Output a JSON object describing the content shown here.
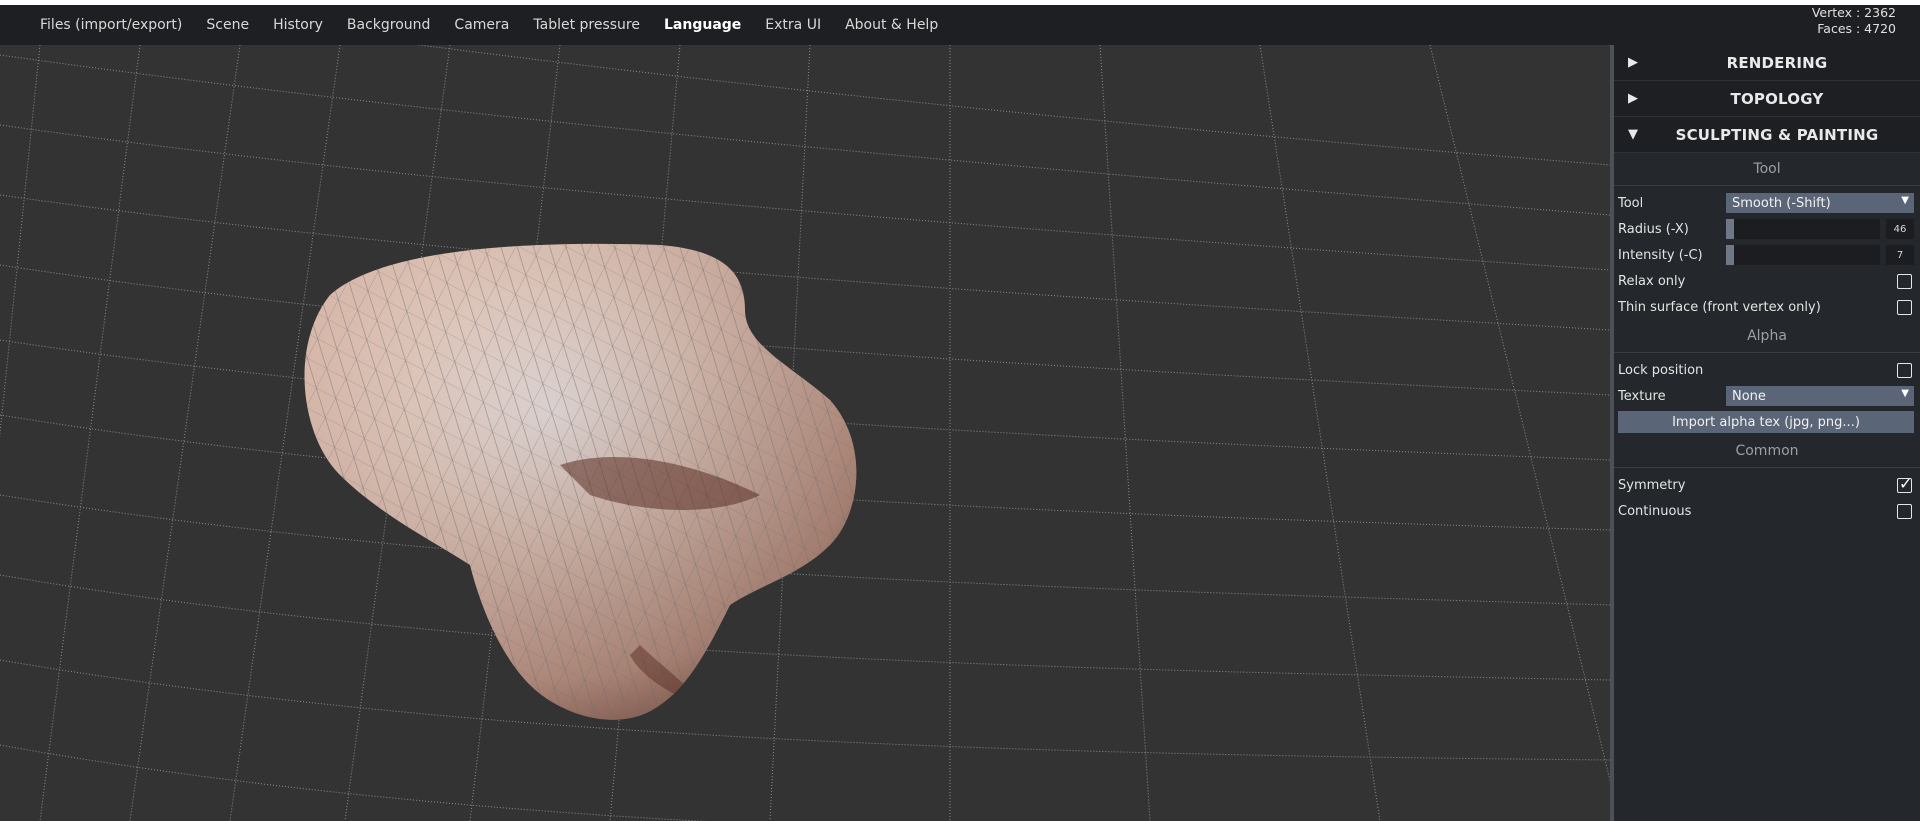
{
  "menu": {
    "items": [
      {
        "label": "Files (import/export)"
      },
      {
        "label": "Scene"
      },
      {
        "label": "History"
      },
      {
        "label": "Background"
      },
      {
        "label": "Camera"
      },
      {
        "label": "Tablet pressure"
      },
      {
        "label": "Language",
        "active": true
      },
      {
        "label": "Extra UI"
      },
      {
        "label": "About & Help"
      }
    ]
  },
  "stats": {
    "vertex": "Vertex : 2362",
    "faces": "Faces : 4720"
  },
  "sidebar": {
    "folders": [
      {
        "arrow": "▶",
        "title": "RENDERING"
      },
      {
        "arrow": "▶",
        "title": "TOPOLOGY"
      },
      {
        "arrow": "▼",
        "title": "SCULPTING & PAINTING"
      }
    ],
    "tool_section": {
      "header": "Tool",
      "tool_label": "Tool",
      "tool_value": "Smooth (-Shift)",
      "radius_label": "Radius (-X)",
      "radius_value": "46",
      "radius_fraction": 0.05,
      "intensity_label": "Intensity (-C)",
      "intensity_value": "7",
      "intensity_fraction": 0.05,
      "relax_label": "Relax only",
      "relax_checked": false,
      "thin_label": "Thin surface (front vertex only)",
      "thin_checked": false
    },
    "alpha_section": {
      "header": "Alpha",
      "lock_label": "Lock position",
      "lock_checked": false,
      "texture_label": "Texture",
      "texture_value": "None",
      "import_button": "Import alpha tex (jpg, png...)"
    },
    "common_section": {
      "header": "Common",
      "symmetry_label": "Symmetry",
      "symmetry_checked": true,
      "continuous_label": "Continuous",
      "continuous_checked": false
    }
  },
  "colors": {
    "menubar_bg": "#1e1f22",
    "viewport_bg": "#333333",
    "grid_line": "#9a9a9a",
    "mesh_skin": "#d9b4a0",
    "sidebar_bg": "#24272b",
    "control_accent": "#5a6577"
  },
  "viewport": {
    "object": "sculpted nose mesh"
  }
}
